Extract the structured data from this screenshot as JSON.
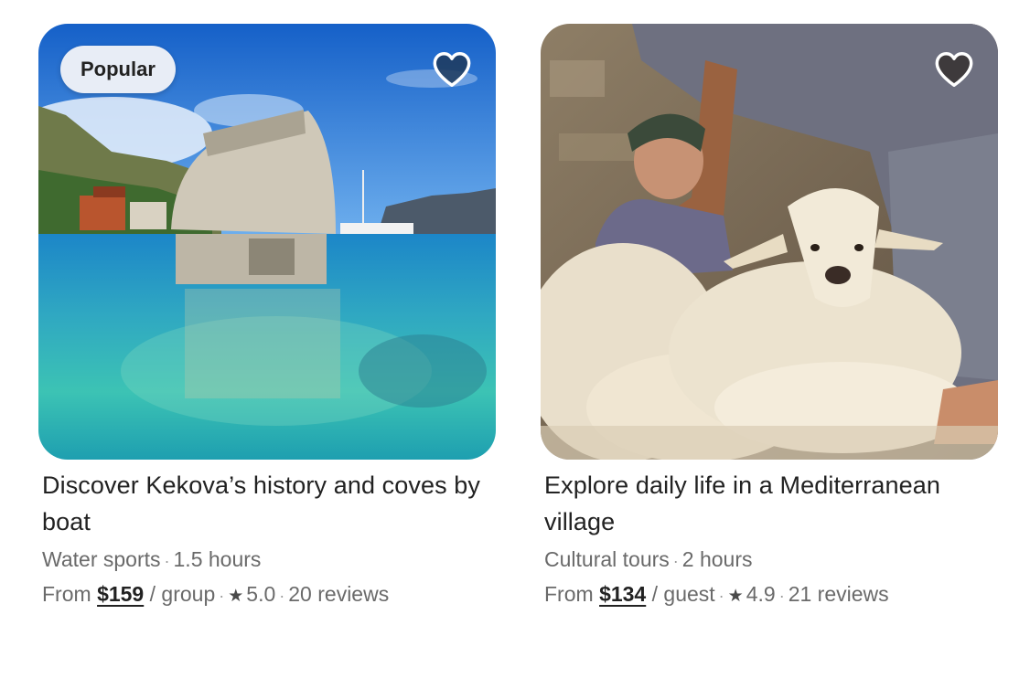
{
  "listings": [
    {
      "badge": "Popular",
      "title": "Discover Kekova’s history and coves by boat",
      "category": "Water sports",
      "duration": "1.5 hours",
      "from_label": "From",
      "price": "$159",
      "unit": "/ group",
      "rating": "5.0",
      "reviews": "20 reviews",
      "favorite_icon": "heart-icon",
      "image_subject": "sunken-tomb-in-turquoise-sea"
    },
    {
      "badge": "",
      "title": "Explore daily life in a Mediterranean village",
      "category": "Cultural tours",
      "duration": "2 hours",
      "from_label": "From",
      "price": "$134",
      "unit": "/ guest",
      "rating": "4.9",
      "reviews": "21 reviews",
      "favorite_icon": "heart-icon",
      "image_subject": "sheep-shearing-in-village"
    }
  ],
  "separator": "·",
  "star_glyph": "★",
  "colors": {
    "primary_text": "#222222",
    "secondary_text": "#6a6a6a",
    "badge_bg": "#e8edf6",
    "heart_fill": "#1f3a5c"
  }
}
